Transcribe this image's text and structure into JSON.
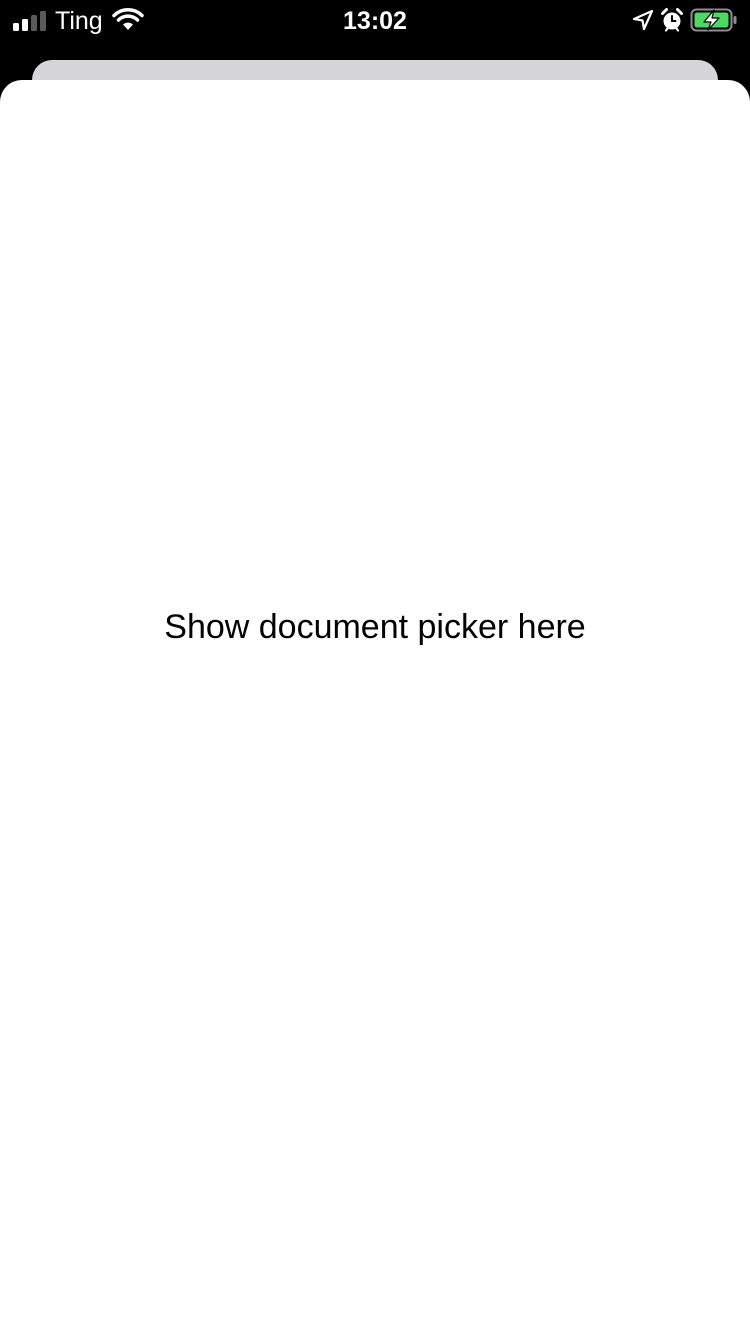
{
  "status_bar": {
    "carrier": "Ting",
    "time": "13:02",
    "icons": [
      "signal-icon",
      "wifi-icon",
      "location-arrow-icon",
      "alarm-clock-icon",
      "battery-charging-icon"
    ],
    "battery_color": "#4cd964"
  },
  "sheet": {
    "message": "Show document picker here",
    "background": "#ffffff",
    "back_card_color": "#d5d5da"
  }
}
